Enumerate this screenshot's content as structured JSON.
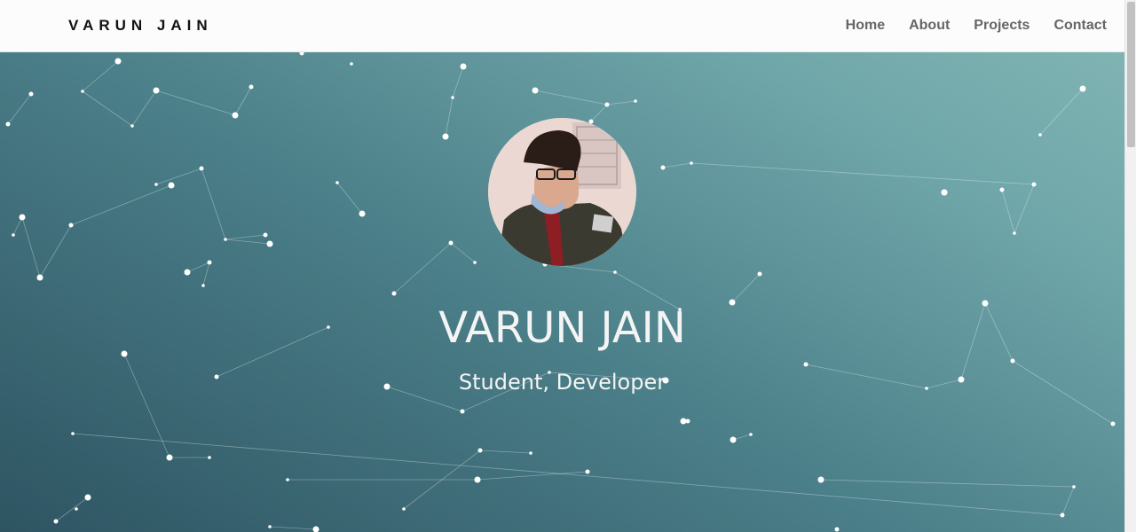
{
  "navbar": {
    "brand": "VARUN JAIN",
    "links": [
      "Home",
      "About",
      "Projects",
      "Contact"
    ]
  },
  "hero": {
    "title": "VARUN JAIN",
    "subtitle": "Student, Developer"
  },
  "colors": {
    "gradient_dark": "#2e5462",
    "gradient_light": "#80b4b3",
    "particle": "#ffffff"
  }
}
